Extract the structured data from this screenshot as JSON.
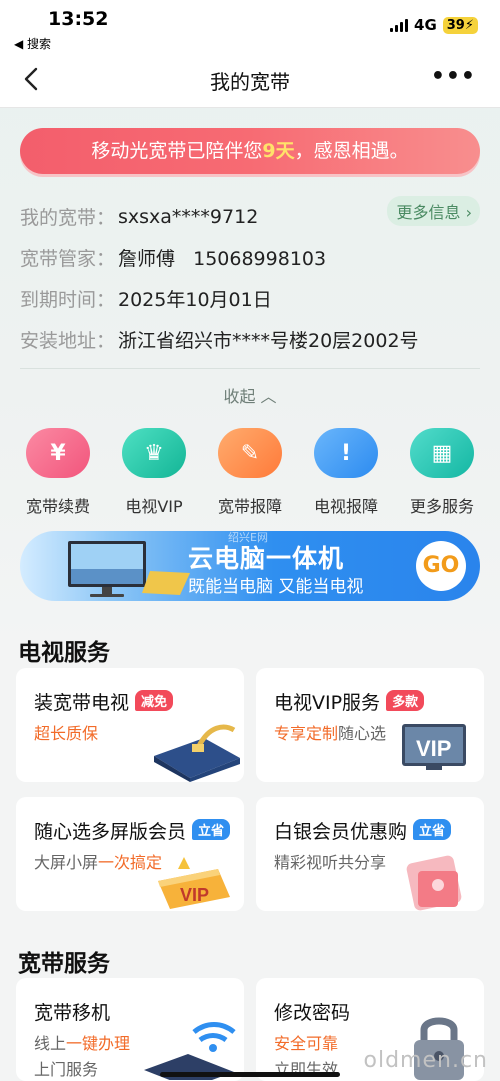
{
  "status": {
    "time": "13:52",
    "back_label": "◀ 搜索",
    "network": "4G",
    "battery": "39"
  },
  "nav": {
    "title": "我的宽带"
  },
  "banner": {
    "text_before": "移动光宽带已陪伴您",
    "days": "9天",
    "text_after": "，感恩相遇。"
  },
  "info": {
    "rows": [
      {
        "label": "我的宽带：",
        "value": "sxsxa****9712"
      },
      {
        "label": "宽带管家：",
        "value": "詹师傅   15068998103"
      },
      {
        "label": "到期时间：",
        "value": "2025年10月01日"
      },
      {
        "label": "安装地址：",
        "value": "浙江省绍兴市****号楼20层2002号"
      }
    ],
    "more_button": "更多信息"
  },
  "collapse_label": "收起",
  "quick_actions": [
    {
      "label": "宽带续费",
      "icon": "money-bag-icon",
      "color": "#f56787",
      "glyph": "¥"
    },
    {
      "label": "电视VIP",
      "icon": "crown-icon",
      "color": "#1fc4a6",
      "glyph": "♛"
    },
    {
      "label": "宽带报障",
      "icon": "wrench-icon",
      "color": "#ff8c4b",
      "glyph": "✎"
    },
    {
      "label": "电视报障",
      "icon": "alert-icon",
      "color": "#3b9cf4",
      "glyph": "!"
    },
    {
      "label": "更多服务",
      "icon": "grid-icon",
      "color": "#23c6b4",
      "glyph": "▦"
    }
  ],
  "ad": {
    "title": "云电脑一体机",
    "subtitle": "既能当电脑 又能当电视",
    "go": "GO",
    "watermark": "绍兴E网"
  },
  "tv_section": {
    "title": "电视服务",
    "cards": [
      {
        "title": "装宽带电视",
        "tag": "减免",
        "tag_color": "#f24a5a",
        "sub_highlight": "超长质保",
        "sub_rest": "",
        "icon": "router-icon"
      },
      {
        "title": "电视VIP服务",
        "tag": "多款",
        "tag_color": "#f24a5a",
        "sub_highlight": "专享定制",
        "sub_rest": "随心选",
        "icon": "tv-vip-icon"
      },
      {
        "title": "随心选多屏版会员",
        "tag": "立省",
        "tag_color": "#2f8ff0",
        "sub_prefix": "大屏小屏",
        "sub_highlight": "一次搞定",
        "icon": "vip-badge-icon"
      },
      {
        "title": "白银会员优惠购",
        "tag": "立省",
        "tag_color": "#2f8ff0",
        "sub_rest": "精彩视听共分享",
        "icon": "gift-icon"
      }
    ]
  },
  "broadband_section": {
    "title": "宽带服务",
    "cards": [
      {
        "title": "宽带移机",
        "line1_prefix": "线上",
        "line1_highlight": "一键办理",
        "line2": "上门服务",
        "icon": "wifi-icon"
      },
      {
        "title": "修改密码",
        "line1_highlight": "安全可靠",
        "line2": "立即生效",
        "icon": "lock-icon"
      }
    ]
  },
  "page_watermark": "oldmen.cn"
}
